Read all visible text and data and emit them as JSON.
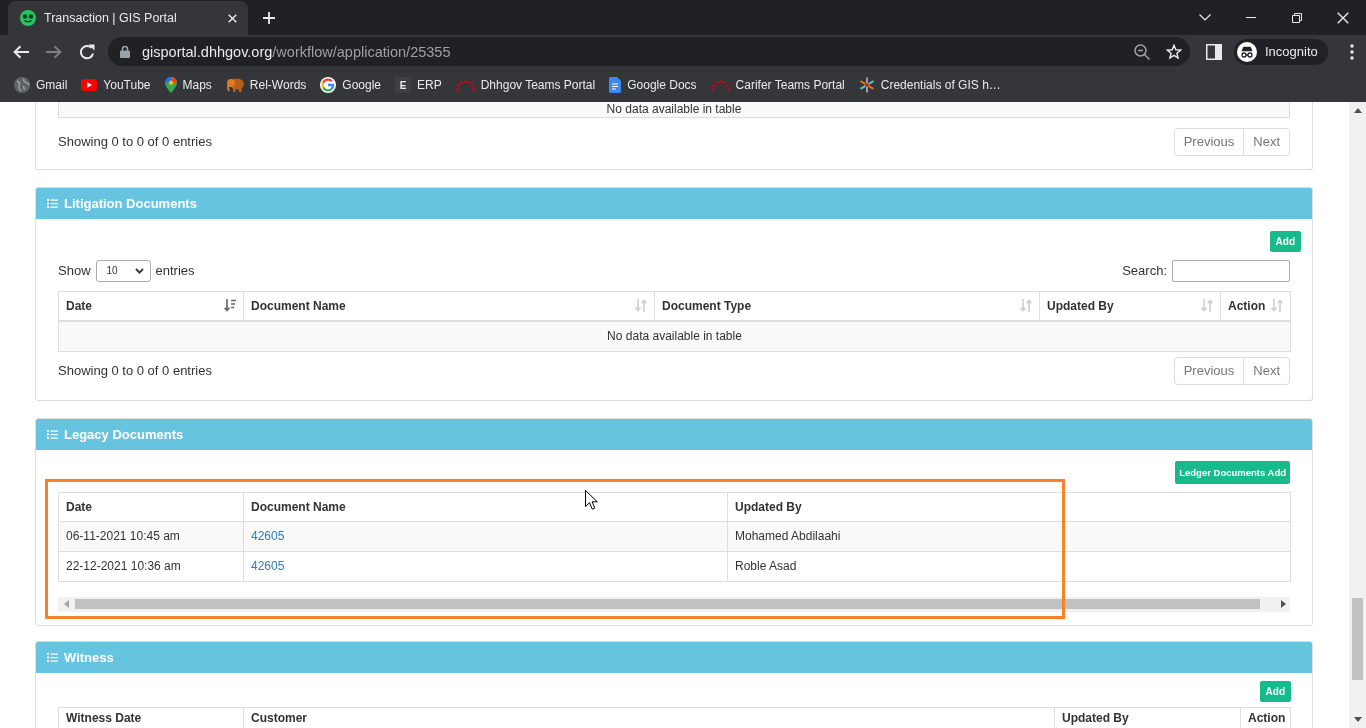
{
  "browser": {
    "tab": {
      "title": "Transaction | GIS Portal",
      "selected": true
    },
    "forward": {
      "disabled": true
    },
    "address": {
      "host": "gisportal.dhhgov.org",
      "path": "/workflow/application/25355"
    },
    "profile": "Incognito",
    "bookmarks": [
      {
        "label": "Gmail"
      },
      {
        "label": "YouTube"
      },
      {
        "label": "Maps"
      },
      {
        "label": "Rel-Words"
      },
      {
        "label": "Google"
      },
      {
        "label": "ERP",
        "icon_text": "E"
      },
      {
        "label": "Dhhgov Teams Portal"
      },
      {
        "label": "Google Docs"
      },
      {
        "label": "Carifer Teams Portal"
      },
      {
        "label": "Credentials of GIS h…"
      }
    ]
  },
  "sections": [
    {
      "kind": "table_end",
      "empty_message": "No data available in table",
      "info": "Showing 0 to 0 of 0 entries",
      "pagination": [
        {
          "label": "Previous",
          "disabled": true
        },
        {
          "label": "Next",
          "disabled": true
        }
      ]
    },
    {
      "kind": "datatable",
      "title": "Litigation Documents",
      "add_button": "Add",
      "length_menu": {
        "label": "Show",
        "value": "10",
        "suffix": "entries"
      },
      "search": {
        "label": "Search:"
      },
      "columns": [
        {
          "label": "Date",
          "sorted": true
        },
        {
          "label": "Document Name",
          "sorted": false
        },
        {
          "label": "Document Type",
          "sorted": false
        },
        {
          "label": "Updated By",
          "sorted": false
        },
        {
          "label": "Action",
          "sorted": false
        }
      ],
      "empty_message": "No data available in table",
      "info": "Showing 0 to 0 of 0 entries",
      "pagination": [
        {
          "label": "Previous",
          "disabled": true
        },
        {
          "label": "Next",
          "disabled": true
        }
      ]
    },
    {
      "kind": "scroll_table",
      "title": "Legacy Documents",
      "add_button": "Ledger Documents Add",
      "highlighted": true,
      "columns": [
        "Date",
        "Document Name",
        "Updated By"
      ],
      "rows": [
        {
          "date": "06-11-2021 10:45 am",
          "document_name": "42605",
          "updated_by": "Mohamed Abdilaahi"
        },
        {
          "date": "22-12-2021 10:36 am",
          "document_name": "42605",
          "updated_by": "Roble Asad"
        }
      ]
    },
    {
      "kind": "table_head",
      "title": "Witness",
      "add_button": "Add",
      "columns": [
        "Witness Date",
        "Customer",
        "Updated By",
        "Action"
      ]
    }
  ]
}
